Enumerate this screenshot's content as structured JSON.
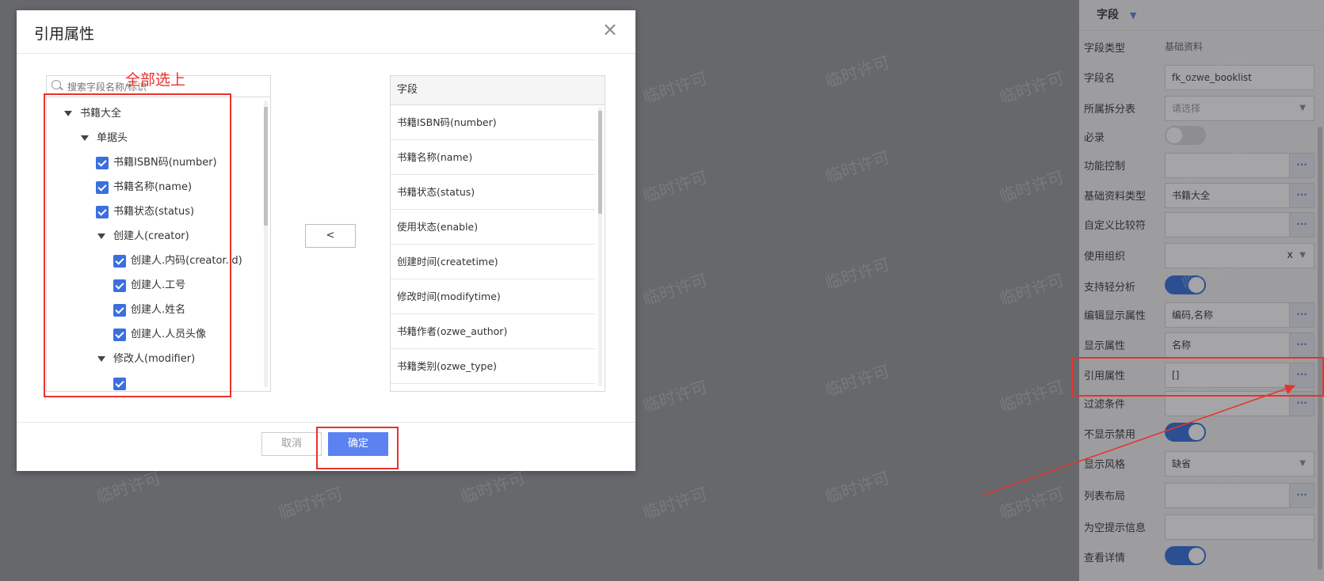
{
  "dialog": {
    "title": "引用属性",
    "close_label": "×",
    "search_placeholder": "搜索字段名称/标识",
    "move_left_label": "<",
    "cancel_label": "取消",
    "ok_label": "确定"
  },
  "annotation": {
    "select_all_note": "全部选上"
  },
  "tree": {
    "root": "书籍大全",
    "header": "单据头",
    "items": [
      "书籍ISBN码(number)",
      "书籍名称(name)",
      "书籍状态(status)"
    ],
    "creator_group": "创建人(creator)",
    "creator_items": [
      "创建人.内码(creator.id)",
      "创建人.工号",
      "创建人.姓名",
      "创建人.人员头像"
    ],
    "modifier_group": "修改人(modifier)"
  },
  "field_table": {
    "header": "字段",
    "rows": [
      "书籍ISBN码(number)",
      "书籍名称(name)",
      "书籍状态(status)",
      "使用状态(enable)",
      "创建时间(createtime)",
      "修改时间(modifytime)",
      "书籍作者(ozwe_author)",
      "书籍类别(ozwe_type)"
    ]
  },
  "panel": {
    "header": "字段",
    "rows": [
      {
        "label": "字段类型",
        "value": "基础资料",
        "kind": "text"
      },
      {
        "label": "字段名",
        "value": "fk_ozwe_booklist",
        "kind": "input"
      },
      {
        "label": "所属拆分表",
        "value": "请选择",
        "kind": "select-placeholder"
      },
      {
        "label": "必录",
        "value": "off",
        "kind": "toggle"
      },
      {
        "label": "功能控制",
        "value": "",
        "kind": "lookup"
      },
      {
        "label": "基础资料类型",
        "value": "书籍大全",
        "kind": "lookup"
      },
      {
        "label": "自定义比较符",
        "value": "",
        "kind": "lookup"
      },
      {
        "label": "使用组织",
        "value": "",
        "kind": "select-clear"
      },
      {
        "label": "支持轻分析",
        "value": "on",
        "kind": "toggle"
      },
      {
        "label": "编辑显示属性",
        "value": "编码,名称",
        "kind": "lookup"
      },
      {
        "label": "显示属性",
        "value": "名称",
        "kind": "lookup"
      },
      {
        "label": "引用属性",
        "value": "[]",
        "kind": "lookup"
      },
      {
        "label": "过滤条件",
        "value": "",
        "kind": "lookup"
      },
      {
        "label": "不显示禁用",
        "value": "on",
        "kind": "toggle"
      },
      {
        "label": "显示风格",
        "value": "缺省",
        "kind": "select"
      },
      {
        "label": "列表布局",
        "value": "",
        "kind": "lookup"
      },
      {
        "label": "为空提示信息",
        "value": "",
        "kind": "input"
      },
      {
        "label": "查看详情",
        "value": "on",
        "kind": "toggle"
      }
    ],
    "lookup_label": "···",
    "select_arrow": "▼",
    "clear_label": "x"
  },
  "watermark": "临时许可",
  "colors": {
    "accent": "#5b82f0",
    "annotation": "#e8322e",
    "toggle_on": "#2f6bd9"
  }
}
